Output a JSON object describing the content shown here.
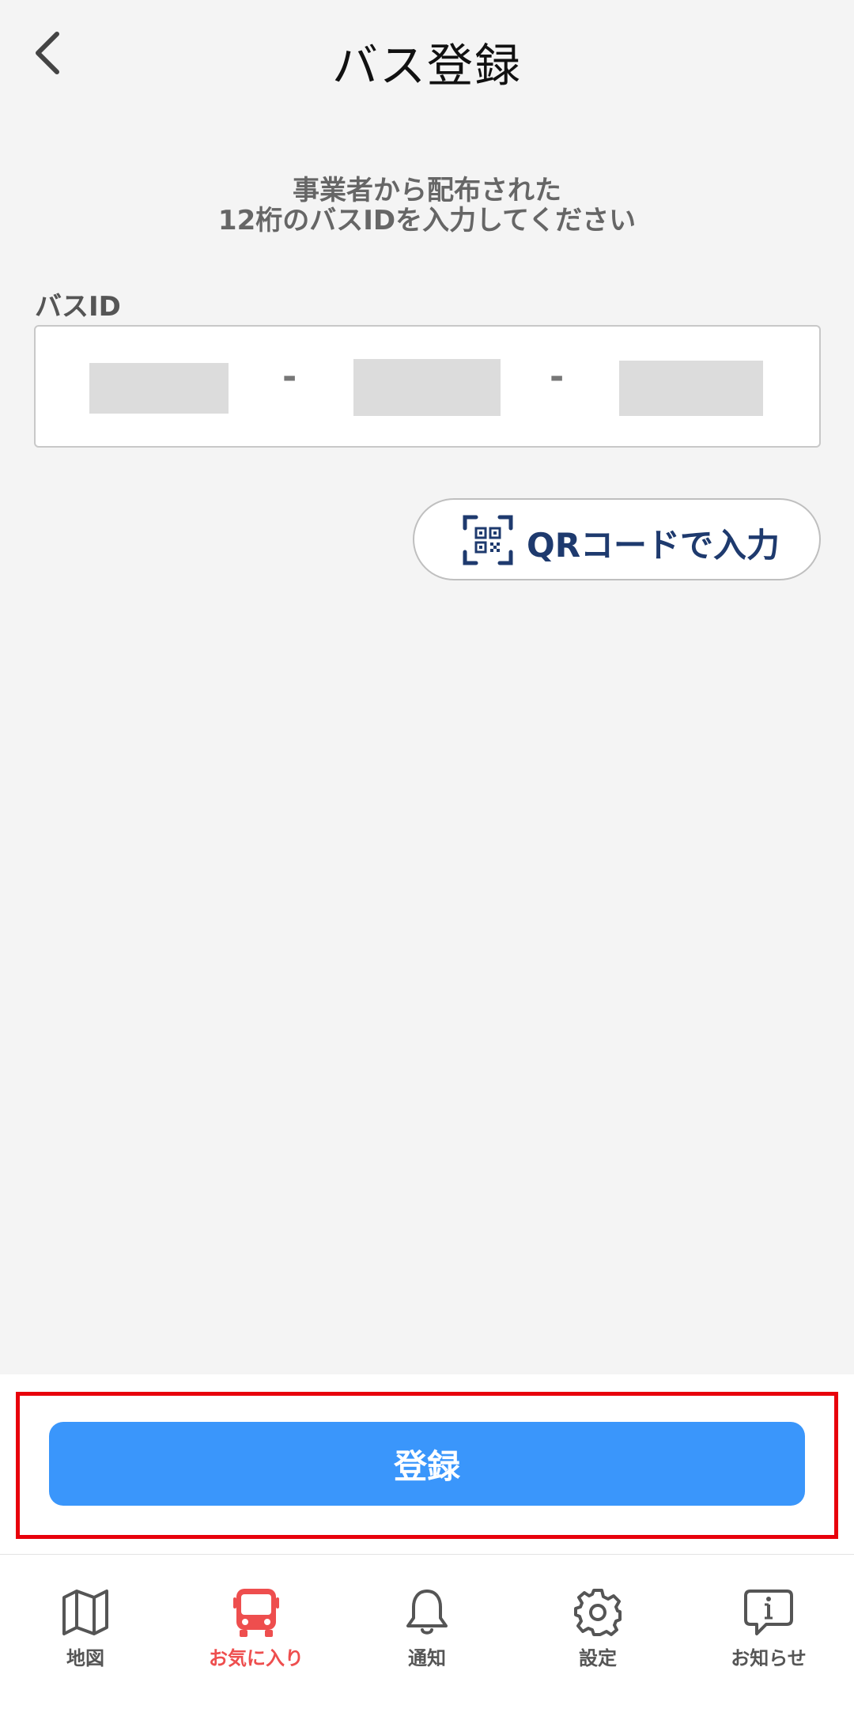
{
  "header": {
    "title": "バス登録",
    "back_icon": "chevron-left-icon"
  },
  "instruction": {
    "line1": "事業者から配布された",
    "line2": "12桁のバスIDを入力してください"
  },
  "bus_id": {
    "label": "バスID",
    "segments": [
      "",
      "",
      ""
    ],
    "separator": "-"
  },
  "qr_button": {
    "label": "QRコードで入力",
    "icon": "qr-code-scan-icon",
    "color": "#1e3a6e"
  },
  "register_button": {
    "label": "登録",
    "color": "#3a96fb"
  },
  "highlight_color": "#e8000b",
  "tabs": [
    {
      "label": "地図",
      "icon": "map-icon",
      "active": false
    },
    {
      "label": "お気に入り",
      "icon": "bus-icon",
      "active": true
    },
    {
      "label": "通知",
      "icon": "bell-icon",
      "active": false
    },
    {
      "label": "設定",
      "icon": "gear-icon",
      "active": false
    },
    {
      "label": "お知らせ",
      "icon": "info-message-icon",
      "active": false
    }
  ],
  "active_tab_color": "#ee4e4e"
}
